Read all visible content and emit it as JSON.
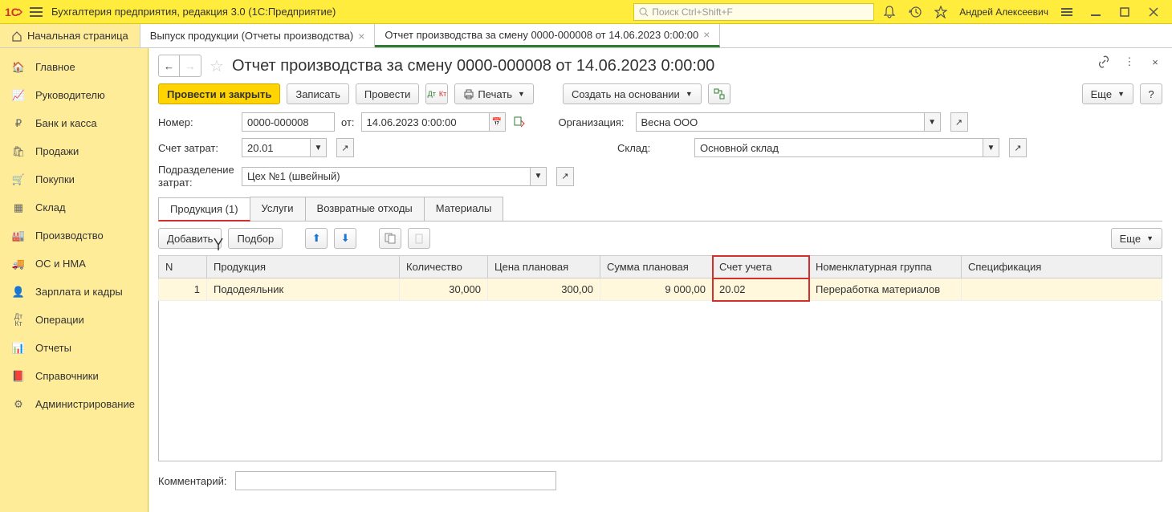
{
  "app": {
    "title": "Бухгалтерия предприятия, редакция 3.0  (1С:Предприятие)",
    "search_placeholder": "Поиск Ctrl+Shift+F",
    "user": "Андрей Алексеевич"
  },
  "tabs": {
    "home": "Начальная страница",
    "t1": "Выпуск продукции (Отчеты производства)",
    "t2": "Отчет производства за смену 0000-000008 от 14.06.2023 0:00:00"
  },
  "sidebar": [
    {
      "icon": "home",
      "label": "Главное"
    },
    {
      "icon": "chart",
      "label": "Руководителю"
    },
    {
      "icon": "ruble",
      "label": "Банк и касса"
    },
    {
      "icon": "bag",
      "label": "Продажи"
    },
    {
      "icon": "cart",
      "label": "Покупки"
    },
    {
      "icon": "box",
      "label": "Склад"
    },
    {
      "icon": "factory",
      "label": "Производство"
    },
    {
      "icon": "truck",
      "label": "ОС и НМА"
    },
    {
      "icon": "person",
      "label": "Зарплата и кадры"
    },
    {
      "icon": "dtkt",
      "label": "Операции"
    },
    {
      "icon": "bars",
      "label": "Отчеты"
    },
    {
      "icon": "book",
      "label": "Справочники"
    },
    {
      "icon": "gear",
      "label": "Администрирование"
    }
  ],
  "doc": {
    "title": "Отчет производства за смену 0000-000008 от 14.06.2023 0:00:00",
    "toolbar": {
      "post_close": "Провести и закрыть",
      "save": "Записать",
      "post": "Провести",
      "print": "Печать",
      "create_based": "Создать на основании",
      "more": "Еще",
      "help": "?"
    },
    "fields": {
      "number_label": "Номер:",
      "number": "0000-000008",
      "from_label": "от:",
      "date": "14.06.2023  0:00:00",
      "org_label": "Организация:",
      "org": "Весна ООО",
      "cost_acc_label": "Счет затрат:",
      "cost_acc": "20.01",
      "warehouse_label": "Склад:",
      "warehouse": "Основной склад",
      "dept_label": "Подразделение затрат:",
      "dept": "Цех №1 (швейный)"
    },
    "doc_tabs": [
      "Продукция (1)",
      "Услуги",
      "Возвратные отходы",
      "Материалы"
    ],
    "tbl_toolbar": {
      "add": "Добавить",
      "pick": "Подбор",
      "more": "Еще"
    },
    "columns": [
      "N",
      "Продукция",
      "Количество",
      "Цена плановая",
      "Сумма плановая",
      "Счет учета",
      "Номенклатурная группа",
      "Спецификация"
    ],
    "rows": [
      {
        "n": "1",
        "product": "Пододеяльник",
        "qty": "30,000",
        "price": "300,00",
        "sum": "9 000,00",
        "acc": "20.02",
        "nomgroup": "Переработка материалов",
        "spec": ""
      }
    ],
    "comment_label": "Комментарий:"
  }
}
